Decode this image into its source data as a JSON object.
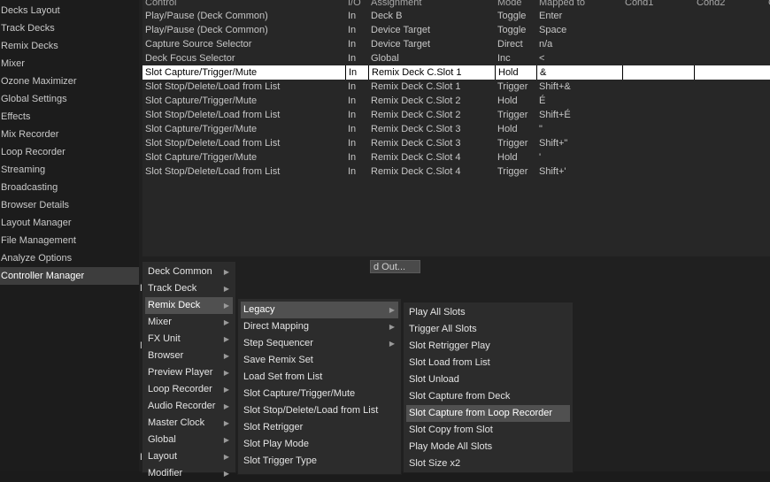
{
  "sidebar": {
    "items": [
      "Decks Layout",
      "Track Decks",
      "Remix Decks",
      "Mixer",
      "Ozone Maximizer",
      "Global Settings",
      "Effects",
      "Mix Recorder",
      "Loop Recorder",
      "Streaming",
      "Broadcasting",
      "Browser Details",
      "Layout Manager",
      "File Management",
      "Analyze Options",
      "Controller Manager"
    ],
    "active": "Controller Manager"
  },
  "table": {
    "headers": [
      "Control",
      "I/O",
      "Assignment",
      "Mode",
      "Mapped to",
      "Cond1",
      "Cond2",
      "C"
    ],
    "rows": [
      [
        "Play/Pause (Deck Common)",
        "In",
        "Deck B",
        "Toggle",
        "Enter"
      ],
      [
        "Play/Pause (Deck Common)",
        "In",
        "Device Target",
        "Toggle",
        "Space"
      ],
      [
        "Capture Source Selector",
        "In",
        "Device Target",
        "Direct",
        "n/a"
      ],
      [
        "Deck Focus Selector",
        "In",
        "Global",
        "Inc",
        "<"
      ],
      [
        "Slot Capture/Trigger/Mute",
        "In",
        "Remix Deck C.Slot 1",
        "Hold",
        "&"
      ],
      [
        "Slot Stop/Delete/Load from List",
        "In",
        "Remix Deck C.Slot 1",
        "Trigger",
        "Shift+&"
      ],
      [
        "Slot Capture/Trigger/Mute",
        "In",
        "Remix Deck C.Slot 2",
        "Hold",
        "É"
      ],
      [
        "Slot Stop/Delete/Load from List",
        "In",
        "Remix Deck C.Slot 2",
        "Trigger",
        "Shift+É"
      ],
      [
        "Slot Capture/Trigger/Mute",
        "In",
        "Remix Deck C.Slot 3",
        "Hold",
        "\""
      ],
      [
        "Slot Stop/Delete/Load from List",
        "In",
        "Remix Deck C.Slot 3",
        "Trigger",
        "Shift+\""
      ],
      [
        "Slot Capture/Trigger/Mute",
        "In",
        "Remix Deck C.Slot 4",
        "Hold",
        "'"
      ],
      [
        "Slot Stop/Delete/Load from List",
        "In",
        "Remix Deck C.Slot 4",
        "Trigger",
        "Shift+'"
      ]
    ],
    "selected_row": 4
  },
  "under_button": {
    "label": "d Out..."
  },
  "edge_letters": {
    "l1": "D",
    "l2": "M",
    "l3": "E"
  },
  "menu1": {
    "items": [
      "Deck Common",
      "Track Deck",
      "Remix Deck",
      "Mixer",
      "FX Unit",
      "Browser",
      "Preview Player",
      "Loop Recorder",
      "Audio Recorder",
      "Master Clock",
      "Global",
      "Layout",
      "Modifier"
    ],
    "highlighted": "Remix Deck"
  },
  "menu2": {
    "items": [
      "Legacy",
      "Direct Mapping",
      "Step Sequencer",
      "Save Remix Set",
      "Load Set from List",
      "Slot Capture/Trigger/Mute",
      "Slot Stop/Delete/Load from List",
      "Slot Retrigger",
      "Slot Play Mode",
      "Slot Trigger Type"
    ],
    "highlighted": "Legacy"
  },
  "menu3": {
    "items": [
      "Play All Slots",
      "Trigger All Slots",
      "Slot Retrigger Play",
      "Slot Load from List",
      "Slot Unload",
      "Slot Capture from Deck",
      "Slot Capture from Loop Recorder",
      "Slot Copy from Slot",
      "Play Mode All Slots",
      "Slot Size x2"
    ],
    "highlighted": "Slot Capture from Loop Recorder"
  },
  "icons": {
    "submenu_arrow": "chevron-right-icon"
  },
  "colors": {
    "background": "#1b1b1b",
    "selected_row": "#ffffff",
    "menu": "#2c2c2c",
    "menu_highlight": "#505050"
  }
}
